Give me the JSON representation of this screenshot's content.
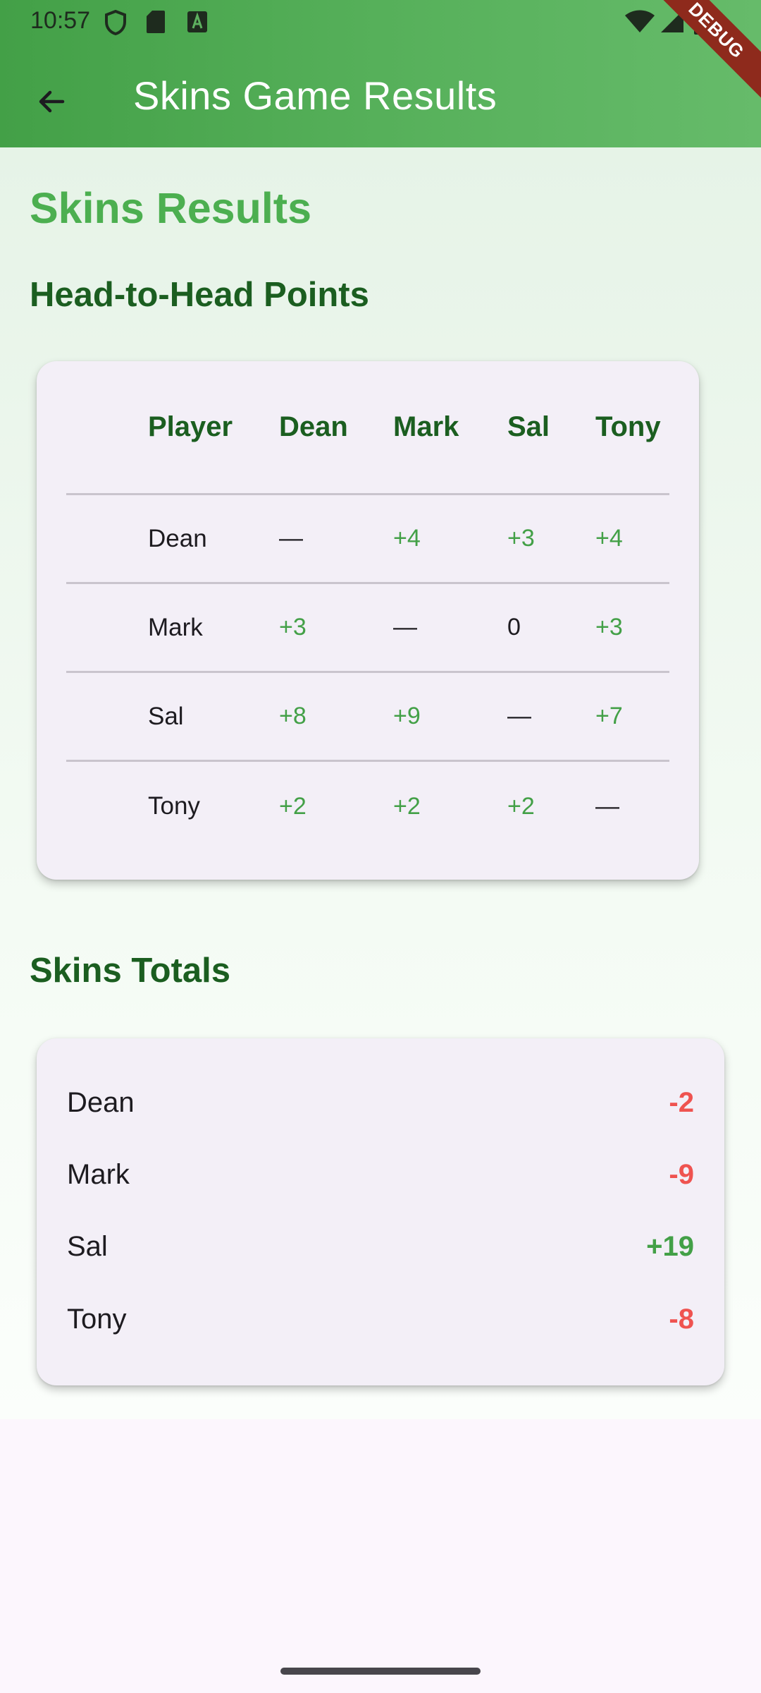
{
  "status_bar": {
    "time": "10:57"
  },
  "app_bar": {
    "title": "Skins Game Results",
    "debug_label": "DEBUG"
  },
  "page": {
    "title": "Skins Results",
    "h2h_heading": "Head-to-Head Points",
    "totals_heading": "Skins Totals"
  },
  "h2h_table": {
    "headers": [
      "Player",
      "Dean",
      "Mark",
      "Sal",
      "Tony"
    ],
    "rows": [
      {
        "player": "Dean",
        "cells": [
          "—",
          "+4",
          "+3",
          "+4"
        ]
      },
      {
        "player": "Mark",
        "cells": [
          "+3",
          "—",
          "0",
          "+3"
        ]
      },
      {
        "player": "Sal",
        "cells": [
          "+8",
          "+9",
          "—",
          "+7"
        ]
      },
      {
        "player": "Tony",
        "cells": [
          "+2",
          "+2",
          "+2",
          "—"
        ]
      }
    ]
  },
  "totals": [
    {
      "name": "Dean",
      "value": "-2"
    },
    {
      "name": "Mark",
      "value": "-9"
    },
    {
      "name": "Sal",
      "value": "+19"
    },
    {
      "name": "Tony",
      "value": "-8"
    }
  ],
  "colors": {
    "app_bar_start": "#43a047",
    "app_bar_end": "#66bb6a",
    "title_green": "#4caf50",
    "heading_dark_green": "#1b5e20",
    "positive": "#43a047",
    "negative": "#ef5350"
  },
  "icons": {
    "back": "arrow-left-icon",
    "status": [
      "shield-icon",
      "sd-card-icon",
      "font-icon",
      "wifi-icon",
      "signal-icon",
      "battery-icon"
    ]
  }
}
